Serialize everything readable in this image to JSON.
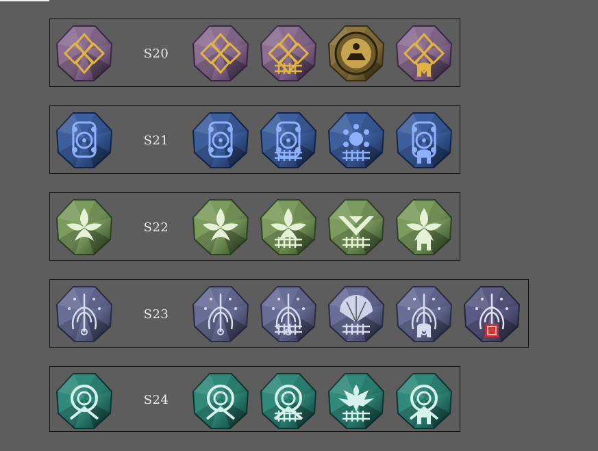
{
  "seasons": [
    {
      "label": "S20",
      "theme": "purple",
      "color": "#8d6e93",
      "dark": "#3a2744",
      "accent": "#e1b53d",
      "main_icon": "diamond-sun-icon",
      "variants": [
        {
          "icon": "diamond-sun-icon",
          "badge": "none"
        },
        {
          "icon": "diamond-sun-icon",
          "badge": "weapon-bars-icon"
        },
        {
          "icon": "pyramid-medallion-icon",
          "badge": "none",
          "special": "gold"
        },
        {
          "icon": "diamond-sun-icon",
          "badge": "helmet-icon"
        }
      ]
    },
    {
      "label": "S21",
      "theme": "blue",
      "color": "#3d5f9e",
      "dark": "#142446",
      "accent": "#8fb0ff",
      "main_icon": "spiral-wheel-icon",
      "variants": [
        {
          "icon": "spiral-wheel-icon",
          "badge": "none"
        },
        {
          "icon": "spiral-wheel-icon",
          "badge": "weapon-bars-icon"
        },
        {
          "icon": "moon-phases-icon",
          "badge": "weapon-bars-icon"
        },
        {
          "icon": "spiral-wheel-icon",
          "badge": "helmet-icon"
        }
      ]
    },
    {
      "label": "S22",
      "theme": "green",
      "color": "#7c9c5e",
      "dark": "#2d4224",
      "accent": "#e6f2d6",
      "main_icon": "lotus-flower-icon",
      "variants": [
        {
          "icon": "lotus-flower-icon",
          "badge": "none"
        },
        {
          "icon": "lotus-flower-icon",
          "badge": "weapon-bars-icon"
        },
        {
          "icon": "chevron-stripes-icon",
          "badge": "weapon-bars-icon"
        },
        {
          "icon": "lotus-flower-icon",
          "badge": "helmet-icon"
        }
      ]
    },
    {
      "label": "S23",
      "theme": "violet",
      "color": "#6a6e96",
      "dark": "#2a2b45",
      "accent": "#d8dcef",
      "main_icon": "seed-tree-icon",
      "variants": [
        {
          "icon": "seed-tree-icon",
          "badge": "none"
        },
        {
          "icon": "seed-tree-icon",
          "badge": "weapon-bars-icon"
        },
        {
          "icon": "fan-icon",
          "badge": "weapon-bars-icon"
        },
        {
          "icon": "seed-tree-icon",
          "badge": "helmet-icon"
        },
        {
          "icon": "seed-tree-icon",
          "badge": "red-chip-icon",
          "special": "red"
        }
      ]
    },
    {
      "label": "S24",
      "theme": "teal",
      "color": "#2f8a7a",
      "dark": "#0d3530",
      "accent": "#d7f2ec",
      "main_icon": "ring-arch-icon",
      "variants": [
        {
          "icon": "ring-arch-icon",
          "badge": "none"
        },
        {
          "icon": "ring-arch-icon",
          "badge": "weapon-bars-icon"
        },
        {
          "icon": "eagle-icon",
          "badge": "weapon-bars-icon"
        },
        {
          "icon": "ring-arch-icon",
          "badge": "helmet-icon"
        }
      ]
    }
  ]
}
